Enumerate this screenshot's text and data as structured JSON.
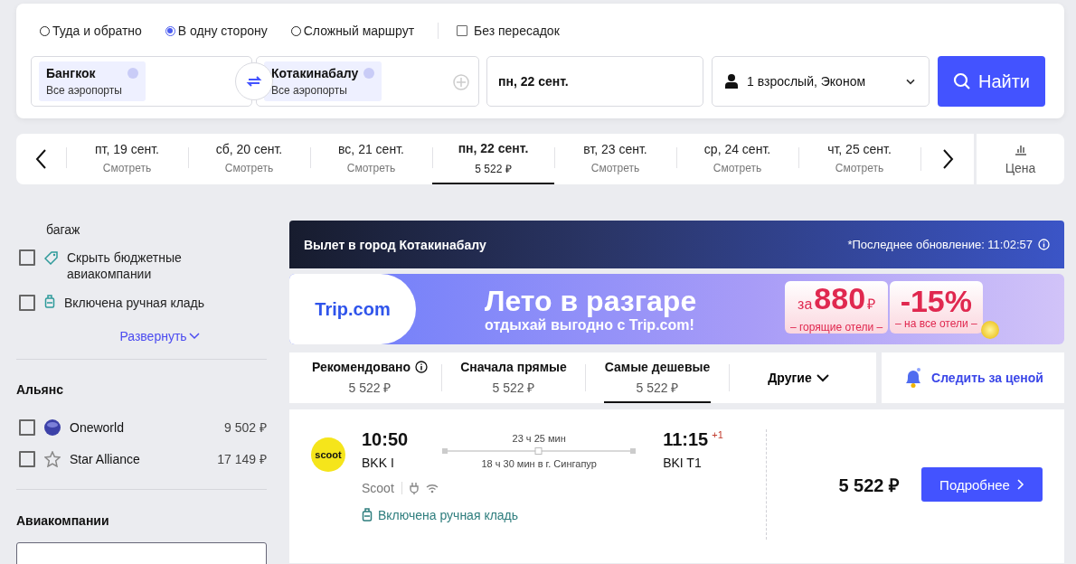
{
  "trip_types": [
    {
      "label": "Туда и обратно",
      "selected": false
    },
    {
      "label": "В одну сторону",
      "selected": true
    },
    {
      "label": "Сложный маршрут",
      "selected": false
    }
  ],
  "nonstop": {
    "label": "Без пересадок",
    "checked": false
  },
  "origin": {
    "city": "Бангкок",
    "airports": "Все аэропорты"
  },
  "destination": {
    "city": "Котакинабалу",
    "airports": "Все аэропорты"
  },
  "date": "пн, 22 сент.",
  "passengers": "1 взрослый, Эконом",
  "search_button": "Найти",
  "dates": [
    {
      "day": "пт, 19 сент.",
      "price": "Смотреть",
      "selected": false
    },
    {
      "day": "сб, 20 сент.",
      "price": "Смотреть",
      "selected": false
    },
    {
      "day": "вс, 21 сент.",
      "price": "Смотреть",
      "selected": false
    },
    {
      "day": "пн, 22 сент.",
      "price": "5 522 ₽",
      "selected": true
    },
    {
      "day": "вт, 23 сент.",
      "price": "Смотреть",
      "selected": false
    },
    {
      "day": "ср, 24 сент.",
      "price": "Смотреть",
      "selected": false
    },
    {
      "day": "чт, 25 сент.",
      "price": "Смотреть",
      "selected": false
    }
  ],
  "price_chart_label": "Цена",
  "sidebar": {
    "cut_text": "багаж",
    "options": [
      {
        "kind": "tag",
        "label": "Скрыть бюджетные авиакомпании",
        "checked": false
      },
      {
        "kind": "bag",
        "label": "Включена ручная кладь",
        "checked": false
      }
    ],
    "expand_link": "Развернуть",
    "alliance_title": "Альянс",
    "alliances": [
      {
        "kind": "globe",
        "name": "Oneworld",
        "price": "9 502 ₽",
        "checked": false
      },
      {
        "kind": "star",
        "name": "Star Alliance",
        "price": "17 149 ₽",
        "checked": false
      }
    ],
    "airlines_title": "Авиакомпании"
  },
  "header": {
    "title": "Вылет в город Котакинабалу",
    "updated": "*Последнее обновление: 11:02:57"
  },
  "ad": {
    "logo": "Trip.com",
    "headline": "Лето в разгаре",
    "subline": "отдыхай выгодно с Trip.com!",
    "badge1_prefix": "за",
    "badge1_amount": "880",
    "badge1_currency": "₽",
    "badge1_caption": "– горящие отели –",
    "badge2_amount": "-15%",
    "badge2_caption": "– на все отели –"
  },
  "sort_tabs": [
    {
      "label": "Рекомендовано",
      "price": "5 522 ₽",
      "info": true,
      "selected": false
    },
    {
      "label": "Сначала прямые",
      "price": "5 522 ₽",
      "info": false,
      "selected": false
    },
    {
      "label": "Самые дешевые",
      "price": "5 522 ₽",
      "info": false,
      "selected": true
    }
  ],
  "other_sort": "Другие",
  "track_price": "Следить за ценой",
  "flight": {
    "logo": "scoot",
    "depart_time": "10:50",
    "depart_airport": "BKK I",
    "duration": "23 ч 25 мин",
    "layover": "18 ч 30 мин в г. Сингапур",
    "arrive_time": "11:15",
    "day_offset": "+1",
    "arrive_airport": "BKI T1",
    "airline": "Scoot",
    "baggage": "Включена ручная кладь",
    "price": "5 522 ₽",
    "details_button": "Подробнее"
  }
}
